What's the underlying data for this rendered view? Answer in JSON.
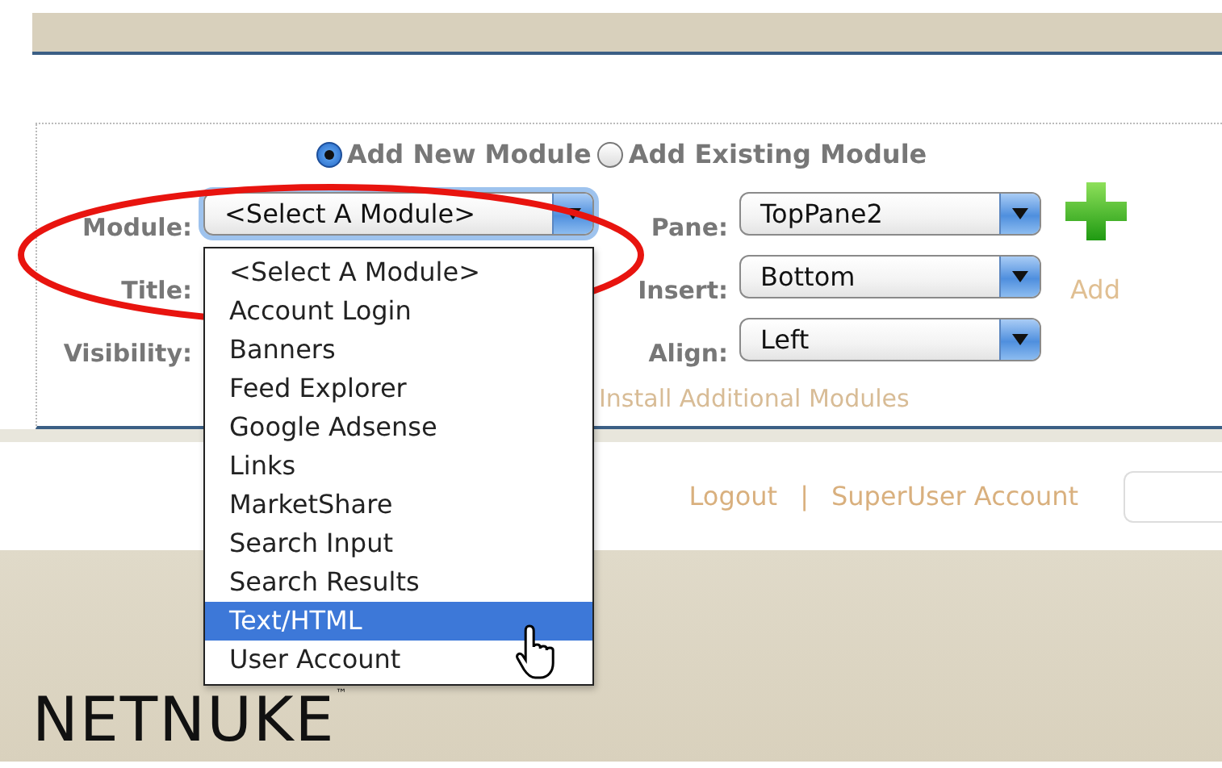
{
  "mode_options": [
    {
      "label": "Add New Module",
      "selected": true
    },
    {
      "label": "Add Existing Module",
      "selected": false
    }
  ],
  "left_fields": [
    {
      "label": "Module:",
      "value": "<Select A Module>",
      "focused": true
    },
    {
      "label": "Title:"
    },
    {
      "label": "Visibility:"
    }
  ],
  "right_fields": [
    {
      "label": "Pane:",
      "value": "TopPane2"
    },
    {
      "label": "Insert:",
      "value": "Bottom"
    },
    {
      "label": "Align:",
      "value": "Left"
    }
  ],
  "add_link": "Add",
  "install_link": "Install Additional Modules",
  "module_menu": [
    {
      "label": "<Select A Module>",
      "selected": false
    },
    {
      "label": "Account Login",
      "selected": false
    },
    {
      "label": "Banners",
      "selected": false
    },
    {
      "label": "Feed Explorer",
      "selected": false
    },
    {
      "label": "Google Adsense",
      "selected": false
    },
    {
      "label": "Links",
      "selected": false
    },
    {
      "label": "MarketShare",
      "selected": false
    },
    {
      "label": "Search Input",
      "selected": false
    },
    {
      "label": "Search Results",
      "selected": false
    },
    {
      "label": "Text/HTML",
      "selected": true
    },
    {
      "label": "User Account",
      "selected": false
    }
  ],
  "user_links": {
    "logout": "Logout",
    "separator": "|",
    "account": "SuperUser Account"
  },
  "logo": {
    "text": "NETNUKE",
    "mark": "™"
  }
}
